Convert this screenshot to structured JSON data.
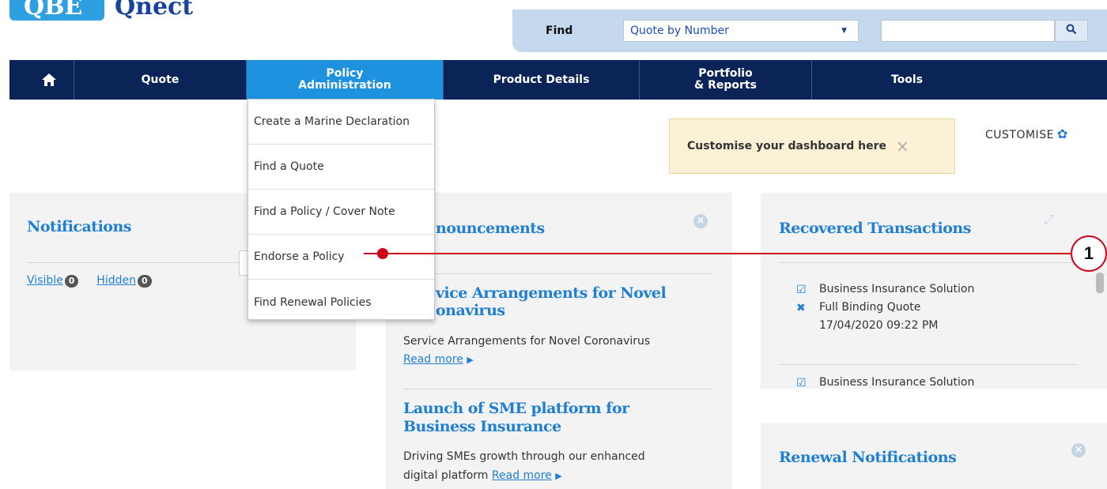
{
  "brand": {
    "logo_mark": "QBE",
    "app_name": "Qnect"
  },
  "find": {
    "label": "Find",
    "select_value": "Quote by Number",
    "input_value": "",
    "search_icon": "search-icon"
  },
  "nav": {
    "home_icon": "home-icon",
    "items": [
      {
        "label": "Quote"
      },
      {
        "label": "Policy\nAdministration",
        "active": true
      },
      {
        "label": "Product Details"
      },
      {
        "label": "Portfolio\n& Reports"
      },
      {
        "label": "Tools"
      }
    ]
  },
  "dropdown": {
    "items": [
      {
        "label": "Create a Marine Declaration"
      },
      {
        "label": "Find a Quote"
      },
      {
        "label": "Find a Policy / Cover Note"
      },
      {
        "label": "Endorse a Policy"
      },
      {
        "label": "Find Renewal Policies"
      }
    ]
  },
  "customise": {
    "banner_text": "Customise your dashboard here",
    "close_glyph": "×",
    "link_label": "CUSTOMISE"
  },
  "notifications": {
    "title": "Notifications",
    "visible_label": "Visible",
    "visible_count": "0",
    "hidden_label": "Hidden",
    "hidden_count": "0"
  },
  "announcements": {
    "title": "nouncements",
    "items": [
      {
        "title_line1": "vice Arrangements for Novel",
        "title_line2": "onavirus",
        "body": "Service Arrangements for Novel Coronavirus",
        "read_more": "Read more"
      },
      {
        "title_line1": "Launch of SME platform for",
        "title_line2": "Business Insurance",
        "body_line1": "Driving SMEs growth through our enhanced",
        "body_line2": "digital platform",
        "read_more": "Read more"
      }
    ]
  },
  "recovered": {
    "title": "Recovered Transactions",
    "entries": [
      {
        "product": "Business Insurance Solution",
        "type": "Full Binding Quote",
        "datetime": "17/04/2020 09:22 PM"
      },
      {
        "product": "Business Insurance Solution"
      }
    ]
  },
  "renewal": {
    "title": "Renewal Notifications"
  },
  "callout": {
    "number": "1"
  },
  "colors": {
    "nav_bg": "#0a2458",
    "active_tab": "#1f92df",
    "link_blue": "#1f7fd4",
    "callout_red": "#d0021b",
    "banner_bg": "#fbf1d6"
  }
}
